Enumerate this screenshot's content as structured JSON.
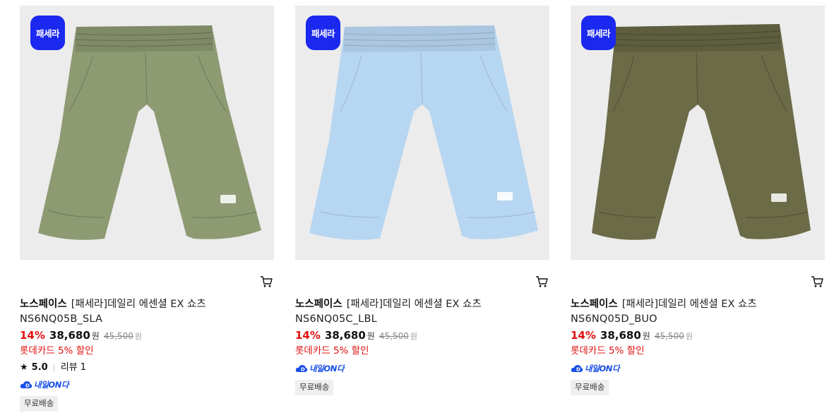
{
  "products": [
    {
      "badge": "패세라",
      "brand": "노스페이스",
      "name": "[패세라]데일리 에센셜 EX 쇼츠",
      "code": "NS6NQ05B_SLA",
      "discount_pct": "14%",
      "price": "38,680",
      "price_unit": "원",
      "original_price": "45,500",
      "original_unit": "원",
      "card_discount": "롯데카드 5% 할인",
      "rating": "5.0",
      "review": "리뷰 1",
      "delivery_label": "내일ON다",
      "shipping_tag": "무료배송",
      "product_color": "#8e9a72",
      "icon": "cart-icon"
    },
    {
      "badge": "패세라",
      "brand": "노스페이스",
      "name": "[패세라]데일리 에센셜 EX 쇼츠",
      "code": "NS6NQ05C_LBL",
      "discount_pct": "14%",
      "price": "38,680",
      "price_unit": "원",
      "original_price": "45,500",
      "original_unit": "원",
      "card_discount": "롯데카드 5% 할인",
      "delivery_label": "내일ON다",
      "shipping_tag": "무료배송",
      "product_color": "#b7d6f1",
      "icon": "cart-icon"
    },
    {
      "badge": "패세라",
      "brand": "노스페이스",
      "name": "[패세라]데일리 에센셜 EX 쇼츠",
      "code": "NS6NQ05D_BUO",
      "discount_pct": "14%",
      "price": "38,680",
      "price_unit": "원",
      "original_price": "45,500",
      "original_unit": "원",
      "card_discount": "롯데카드 5% 할인",
      "delivery_label": "내일ON다",
      "shipping_tag": "무료배송",
      "product_color": "#6b6b48",
      "icon": "cart-icon"
    }
  ],
  "colors": {
    "badge_bg": "#1b28f0",
    "discount_red": "#e01010",
    "delivery_blue": "#1a4fe8",
    "thumb_bg": "#ececec"
  }
}
